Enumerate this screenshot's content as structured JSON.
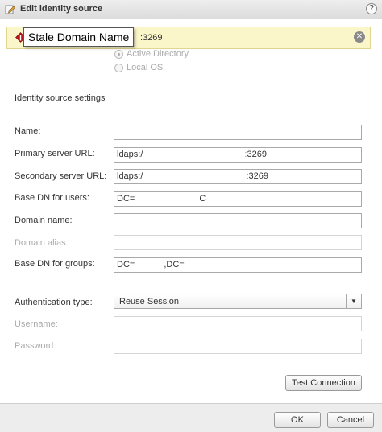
{
  "dialog": {
    "title": "Edit identity source",
    "help_symbol": "?"
  },
  "error": {
    "tooltip": "Stale Domain Name",
    "message_suffix": ":3269",
    "close_symbol": "✕"
  },
  "source_type": {
    "options": [
      "Active Directory",
      "Local OS"
    ],
    "selected": "Active Directory"
  },
  "settings": {
    "heading": "Identity source settings",
    "name": {
      "label": "Name:",
      "value": ""
    },
    "primary_url": {
      "label": "Primary server URL:",
      "value_prefix": "ldaps:/",
      "value_suffix": "3269"
    },
    "secondary_url": {
      "label": "Secondary server URL:",
      "value_prefix": "ldaps:/",
      "value_suffix": ":3269"
    },
    "base_dn_users": {
      "label": "Base DN for users:",
      "value_prefix": "DC=",
      "value_suffix": "C"
    },
    "domain_name": {
      "label": "Domain name:",
      "value": ""
    },
    "domain_alias": {
      "label": "Domain alias:",
      "value": ""
    },
    "base_dn_groups": {
      "label": "Base DN for groups:",
      "value_prefix": "DC=",
      "value_middle": ",DC="
    },
    "auth_type": {
      "label": "Authentication type:",
      "value": "Reuse Session"
    },
    "username": {
      "label": "Username:",
      "value": ""
    },
    "password": {
      "label": "Password:",
      "value": ""
    }
  },
  "buttons": {
    "test_connection": "Test Connection",
    "ok": "OK",
    "cancel": "Cancel"
  }
}
